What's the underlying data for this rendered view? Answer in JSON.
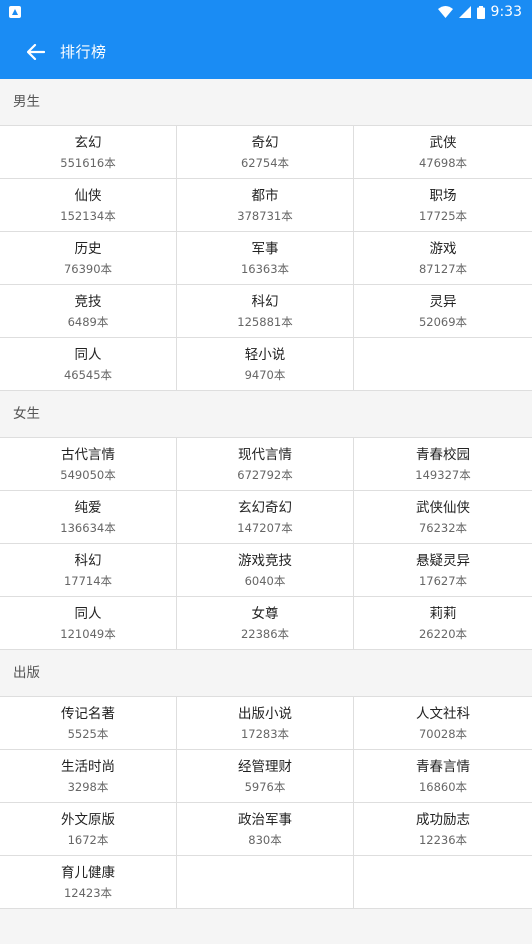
{
  "status_bar": {
    "time": "9:33"
  },
  "app_bar": {
    "title": "排行榜"
  },
  "sections": [
    {
      "title": "男生",
      "items": [
        {
          "name": "玄幻",
          "count": "551616本"
        },
        {
          "name": "奇幻",
          "count": "62754本"
        },
        {
          "name": "武侠",
          "count": "47698本"
        },
        {
          "name": "仙侠",
          "count": "152134本"
        },
        {
          "name": "都市",
          "count": "378731本"
        },
        {
          "name": "职场",
          "count": "17725本"
        },
        {
          "name": "历史",
          "count": "76390本"
        },
        {
          "name": "军事",
          "count": "16363本"
        },
        {
          "name": "游戏",
          "count": "87127本"
        },
        {
          "name": "竞技",
          "count": "6489本"
        },
        {
          "name": "科幻",
          "count": "125881本"
        },
        {
          "name": "灵异",
          "count": "52069本"
        },
        {
          "name": "同人",
          "count": "46545本"
        },
        {
          "name": "轻小说",
          "count": "9470本"
        }
      ]
    },
    {
      "title": "女生",
      "items": [
        {
          "name": "古代言情",
          "count": "549050本"
        },
        {
          "name": "现代言情",
          "count": "672792本"
        },
        {
          "name": "青春校园",
          "count": "149327本"
        },
        {
          "name": "纯爱",
          "count": "136634本"
        },
        {
          "name": "玄幻奇幻",
          "count": "147207本"
        },
        {
          "name": "武侠仙侠",
          "count": "76232本"
        },
        {
          "name": "科幻",
          "count": "17714本"
        },
        {
          "name": "游戏竞技",
          "count": "6040本"
        },
        {
          "name": "悬疑灵异",
          "count": "17627本"
        },
        {
          "name": "同人",
          "count": "121049本"
        },
        {
          "name": "女尊",
          "count": "22386本"
        },
        {
          "name": "莉莉",
          "count": "26220本"
        }
      ]
    },
    {
      "title": "出版",
      "items": [
        {
          "name": "传记名著",
          "count": "5525本"
        },
        {
          "name": "出版小说",
          "count": "17283本"
        },
        {
          "name": "人文社科",
          "count": "70028本"
        },
        {
          "name": "生活时尚",
          "count": "3298本"
        },
        {
          "name": "经管理财",
          "count": "5976本"
        },
        {
          "name": "青春言情",
          "count": "16860本"
        },
        {
          "name": "外文原版",
          "count": "1672本"
        },
        {
          "name": "政治军事",
          "count": "830本"
        },
        {
          "name": "成功励志",
          "count": "12236本"
        },
        {
          "name": "育儿健康",
          "count": "12423本"
        }
      ]
    }
  ]
}
